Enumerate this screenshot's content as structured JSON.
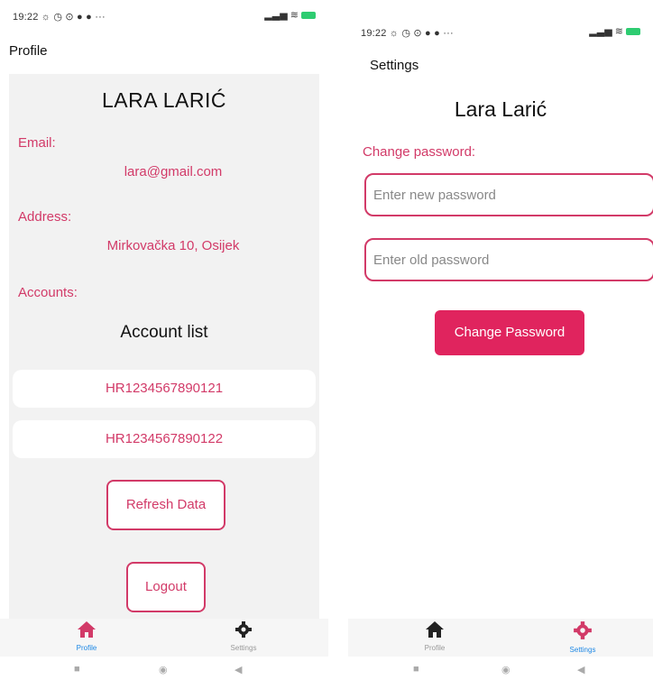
{
  "status_bar": {
    "time": "19:22",
    "dots": "···"
  },
  "profile_screen": {
    "title": "Profile",
    "name": "LARA LARIĆ",
    "email_label": "Email:",
    "email": "lara@gmail.com",
    "address_label": "Address:",
    "address": "Mirkovačka 10, Osijek",
    "accounts_label": "Accounts:",
    "account_list_title": "Account list",
    "accounts": [
      "HR1234567890121",
      "HR1234567890122"
    ],
    "refresh_button": "Refresh Data",
    "logout_button": "Logout",
    "active_tab": "Profile"
  },
  "settings_screen": {
    "title": "Settings",
    "name": "Lara Larić",
    "change_password_label": "Change password:",
    "new_password_placeholder": "Enter new password",
    "old_password_placeholder": "Enter old password",
    "change_password_button": "Change Password",
    "active_tab": "Settings"
  },
  "bottom_nav": {
    "profile_label": "Profile",
    "settings_label": "Settings"
  },
  "icons": {
    "home": "home-icon",
    "settings": "gear-icon"
  },
  "colors": {
    "accent": "#d23a68",
    "button_fill": "#e0245e",
    "active_tab_label": "#1e88e5",
    "battery": "#2ecc71"
  }
}
